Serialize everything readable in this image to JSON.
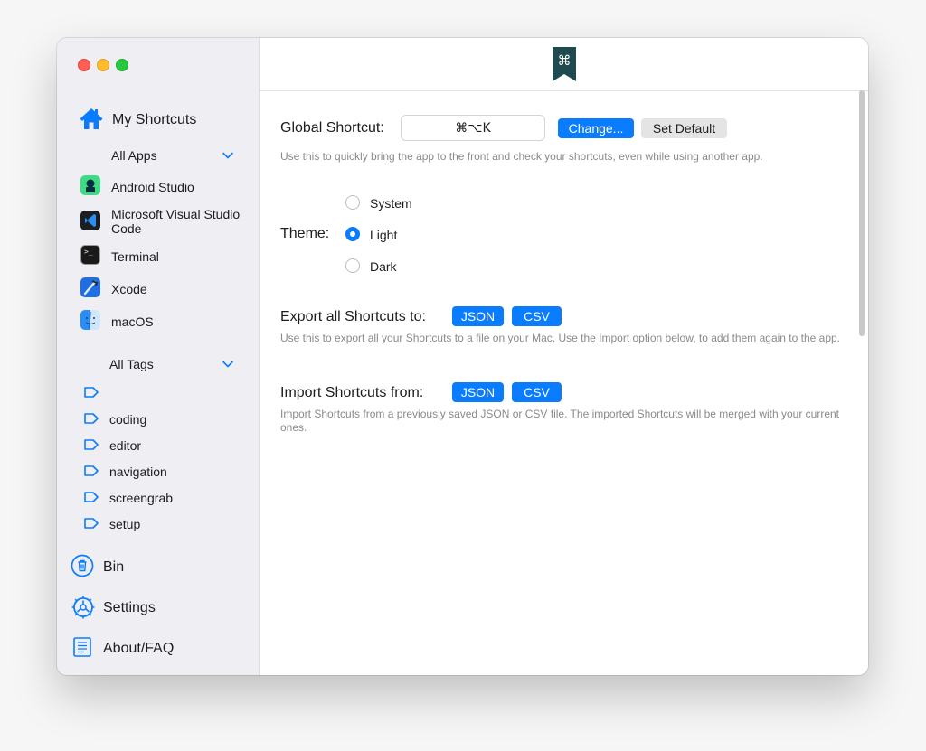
{
  "window": {
    "app_icon": "command-bookmark-icon",
    "app_icon_glyph": "⌘"
  },
  "sidebar": {
    "my_shortcuts": {
      "label": "My Shortcuts",
      "icon": "house-icon"
    },
    "all_apps": {
      "label": "All Apps",
      "icon": "chevron-down-icon"
    },
    "apps": [
      {
        "label": "Android Studio",
        "icon": "android-studio-icon"
      },
      {
        "label": "Microsoft Visual Studio Code",
        "icon": "vscode-icon"
      },
      {
        "label": "Terminal",
        "icon": "terminal-icon",
        "glyph": ">_"
      },
      {
        "label": "Xcode",
        "icon": "xcode-icon"
      },
      {
        "label": "macOS",
        "icon": "finder-icon"
      }
    ],
    "all_tags": {
      "label": "All Tags",
      "icon": "chevron-down-icon"
    },
    "tags": [
      {
        "label": "",
        "icon": "tag-icon"
      },
      {
        "label": "coding",
        "icon": "tag-icon"
      },
      {
        "label": "editor",
        "icon": "tag-icon"
      },
      {
        "label": "navigation",
        "icon": "tag-icon"
      },
      {
        "label": "screengrab",
        "icon": "tag-icon"
      },
      {
        "label": "setup",
        "icon": "tag-icon"
      }
    ],
    "bin": {
      "label": "Bin",
      "icon": "trash-icon"
    },
    "settings": {
      "label": "Settings",
      "icon": "gear-icon"
    },
    "about": {
      "label": "About/FAQ",
      "icon": "document-icon"
    }
  },
  "settings": {
    "global_shortcut": {
      "label": "Global Shortcut:",
      "value": "⌘⌥K",
      "change_label": "Change...",
      "default_label": "Set Default",
      "description": "Use this to quickly bring the app to the front and check your shortcuts, even while using another app."
    },
    "theme": {
      "label": "Theme:",
      "options": [
        "System",
        "Light",
        "Dark"
      ],
      "selected": "Light"
    },
    "export": {
      "label": "Export all Shortcuts to:",
      "json_label": "JSON",
      "csv_label": "CSV",
      "description": "Use this to export all your Shortcuts to a file on your Mac. Use the Import option below, to add them again to the app."
    },
    "import": {
      "label": "Import Shortcuts from:",
      "json_label": "JSON",
      "csv_label": "CSV",
      "description": "Import Shortcuts from a previously saved JSON or CSV file. The imported Shortcuts will be merged with your current ones."
    }
  },
  "colors": {
    "accent": "#0a7cff",
    "sidebar_bg": "#eeeef3",
    "app_icon_bg": "#1f4a4f"
  }
}
